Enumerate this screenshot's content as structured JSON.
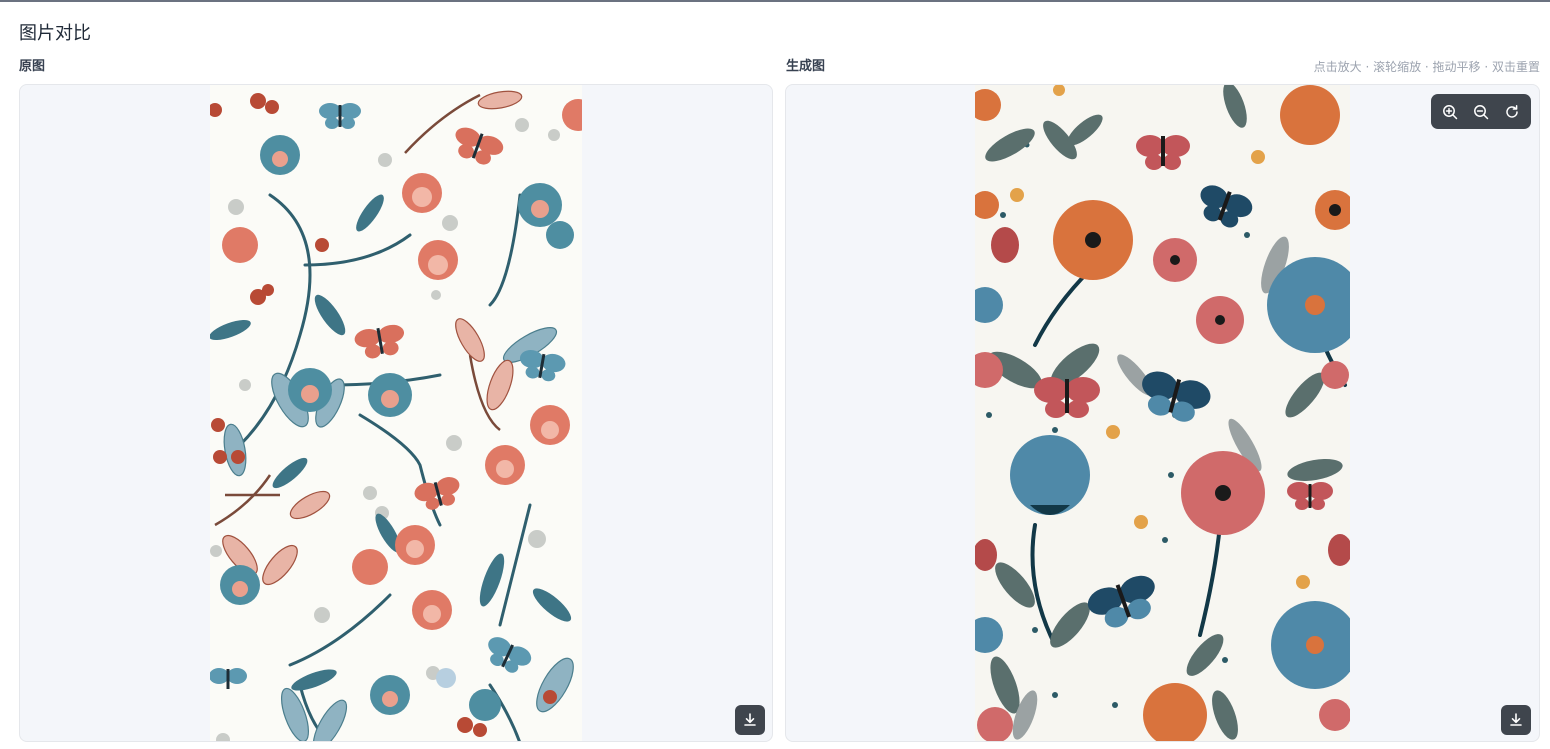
{
  "page": {
    "title": "图片对比"
  },
  "left": {
    "label": "原图"
  },
  "right": {
    "label": "生成图",
    "hint": "点击放大 · 滚轮缩放 · 拖动平移 · 双击重置"
  },
  "icons": {
    "zoom_in": "zoom-in-icon",
    "zoom_out": "zoom-out-icon",
    "reset": "reset-icon",
    "download": "download-icon"
  },
  "colors": {
    "panel_bg": "#f4f6fa",
    "control_bg": "#3f454d",
    "original_bg": "#fbfbf7",
    "generated_bg": "#f7f6f1"
  }
}
